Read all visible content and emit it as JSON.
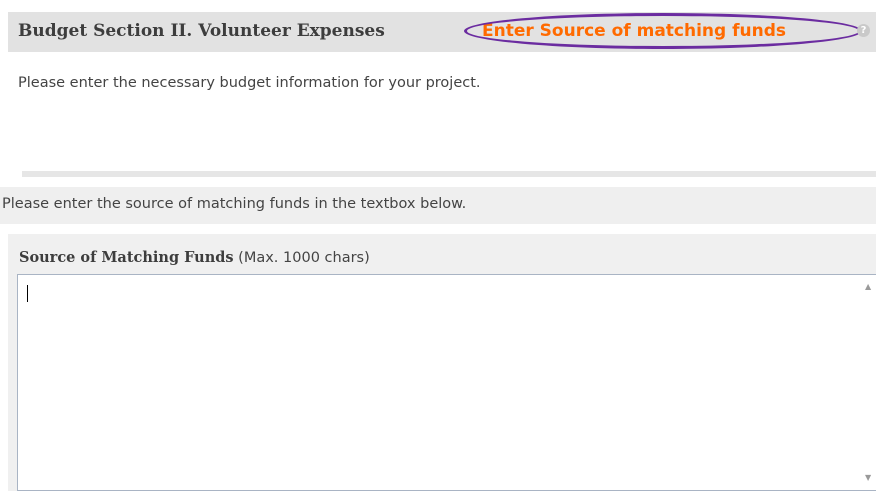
{
  "section": {
    "title": "Budget Section II. Volunteer Expenses",
    "link_label": "Enter Source of matching funds",
    "help_glyph": "?",
    "description": "Please enter the necessary budget information for your project."
  },
  "instruction": {
    "text": "Please enter the source of matching funds in the textbox below."
  },
  "field": {
    "label": "Source of Matching Funds",
    "hint": " (Max. 1000 chars)",
    "value": ""
  },
  "scrollbar": {
    "up_glyph": "▲",
    "down_glyph": "▼"
  },
  "colors": {
    "link": "#ff6a00",
    "annotation": "#6b2ca0",
    "header_bg": "#e2e2e2"
  },
  "icons": [
    "help-icon",
    "scroll-up-arrow-icon",
    "scroll-down-arrow-icon"
  ]
}
